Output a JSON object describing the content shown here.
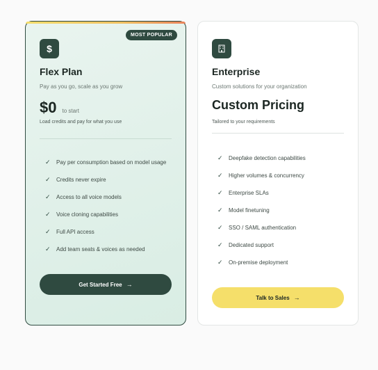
{
  "flex": {
    "badge": "MOST POPULAR",
    "icon": "dollar-icon",
    "icon_glyph": "$",
    "name": "Flex Plan",
    "description": "Pay as you go, scale as you grow",
    "price": "$0",
    "price_suffix": "to start",
    "price_note": "Load credits and pay for what you use",
    "features": [
      "Pay per consumption based on model usage",
      "Credits never expire",
      "Access to all voice models",
      "Voice cloning capabilities",
      "Full API access",
      "Add team seats & voices as needed"
    ],
    "cta_label": "Get Started Free",
    "cta_arrow": "→"
  },
  "enterprise": {
    "icon": "building-icon",
    "name": "Enterprise",
    "description": "Custom solutions for your organization",
    "price": "Custom Pricing",
    "price_note": "Tailored to your requirements",
    "features": [
      "Deepfake detection capabilities",
      "Higher volumes & concurrency",
      "Enterprise SLAs",
      "Model finetuning",
      "SSO / SAML authentication",
      "Dedicated support",
      "On-premise deployment"
    ],
    "cta_label": "Talk to Sales",
    "cta_arrow": "→"
  },
  "check_glyph": "✓",
  "colors": {
    "brand_green": "#2f4a40",
    "accent_yellow": "#f5df6a",
    "flex_bg": "#e3f1eb"
  }
}
